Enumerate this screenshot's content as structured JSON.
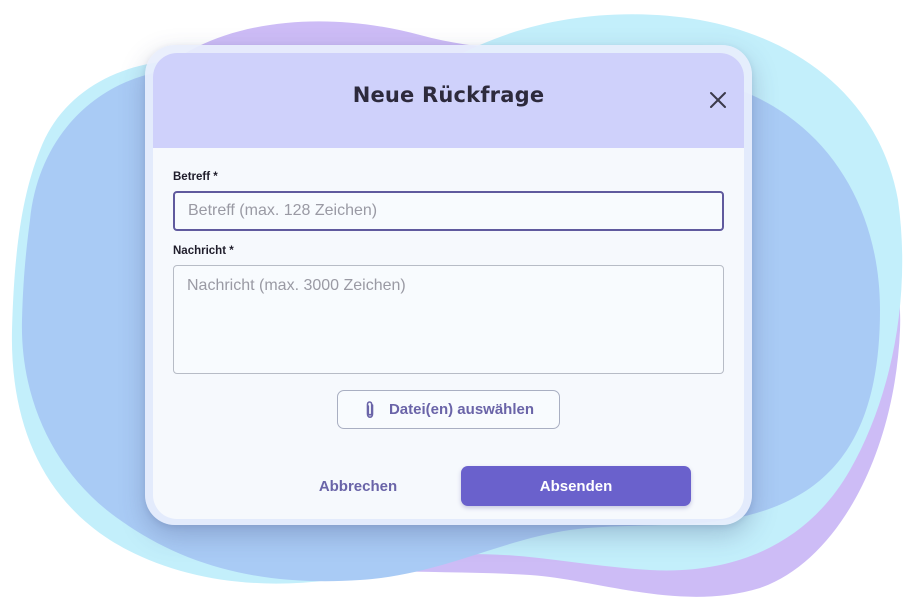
{
  "dialog": {
    "title": "Neue Rückfrage",
    "close_icon": "close-icon"
  },
  "subject": {
    "label": "Betreff *",
    "value": "",
    "placeholder": "Betreff (max. 128 Zeichen)"
  },
  "message": {
    "label": "Nachricht *",
    "value": "",
    "placeholder": "Nachricht (max. 3000 Zeichen)"
  },
  "attachment": {
    "label": "Datei(en) auswählen",
    "icon": "paperclip-icon"
  },
  "actions": {
    "cancel_label": "Abbrechen",
    "submit_label": "Absenden"
  },
  "colors": {
    "header_bg": "#cfd1fb",
    "accent": "#6a61cc",
    "accent_text": "#6a64a8",
    "blob_blue": "#a9cbf5",
    "blob_cyan": "#c3effb",
    "blob_purple": "#cdbcf6"
  }
}
